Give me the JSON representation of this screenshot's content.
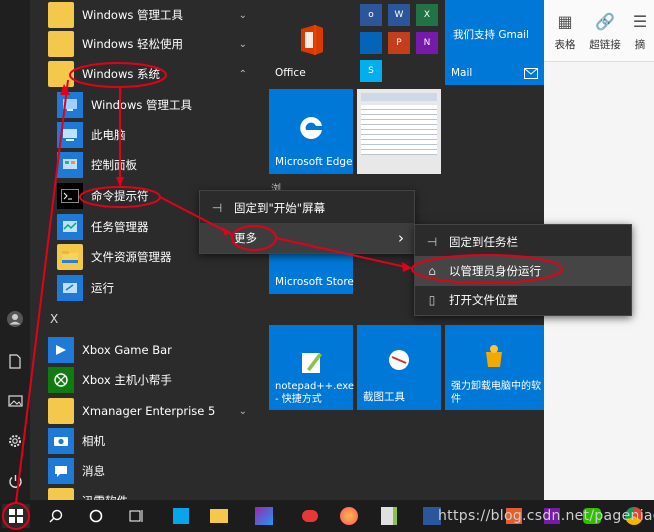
{
  "app_list": {
    "items": [
      {
        "label": "Windows 管理工具",
        "icon": "folder-icon",
        "chevron": "⌄"
      },
      {
        "label": "Windows 轻松使用",
        "icon": "folder-icon",
        "chevron": "⌄"
      },
      {
        "label": "Windows 系统",
        "icon": "folder-icon",
        "chevron": "⌃"
      },
      {
        "label": "Windows 管理工具",
        "icon": "admin-tools-icon"
      },
      {
        "label": "此电脑",
        "icon": "computer-icon"
      },
      {
        "label": "控制面板",
        "icon": "control-panel-icon"
      },
      {
        "label": "命令提示符",
        "icon": "cmd-icon"
      },
      {
        "label": "任务管理器",
        "icon": "task-manager-icon"
      },
      {
        "label": "文件资源管理器",
        "icon": "file-explorer-icon"
      },
      {
        "label": "运行",
        "icon": "run-icon"
      }
    ],
    "section_letter": "X",
    "x_items": [
      {
        "label": "Xbox Game Bar",
        "icon": "xbox-game-bar-icon"
      },
      {
        "label": "Xbox 主机小帮手",
        "icon": "xbox-companion-icon"
      },
      {
        "label": "Xmanager Enterprise 5",
        "icon": "folder-icon",
        "chevron": "⌄"
      },
      {
        "label": "相机",
        "icon": "camera-icon"
      },
      {
        "label": "消息",
        "icon": "messaging-icon"
      },
      {
        "label": "迅雷软件",
        "icon": "folder-icon"
      }
    ]
  },
  "tiles": {
    "office": "Office",
    "gmail": "我们支持 Gmail",
    "mail": "Mail",
    "edge": "Microsoft Edge",
    "browse_partial": "浏",
    "store": "Microsoft Store",
    "notepad": "notepad++.exe - 快捷方式",
    "screenshot": "截图工具",
    "uninstall": "强力卸载电脑中的软件"
  },
  "context_menu_1": {
    "pin_start": "固定到\"开始\"屏幕",
    "more": "更多",
    "more_arrow": "›"
  },
  "context_menu_2": {
    "pin_taskbar": "固定到任务栏",
    "run_as_admin": "以管理员身份运行",
    "open_location": "打开文件位置"
  },
  "doc_toolbar": {
    "table": "表格",
    "hyperlink": "超链接",
    "partial": "摘"
  },
  "watermark": "https://blog.csdn.net/pageniao",
  "colors": {
    "tile_blue": "#0078d7",
    "annotation_red": "#e4001b"
  }
}
